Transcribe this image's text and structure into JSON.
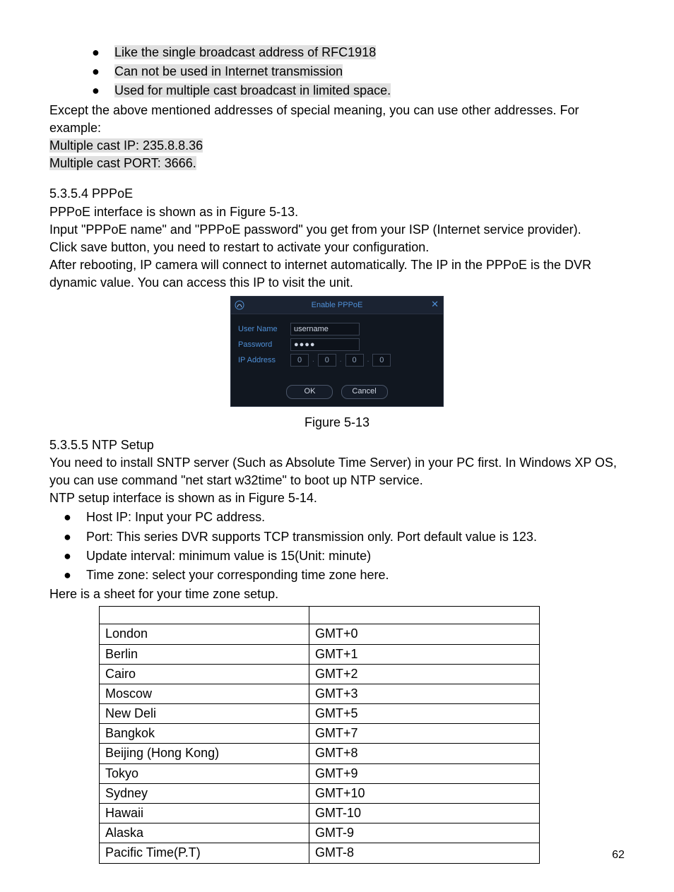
{
  "intro_bullets": [
    "Like the single broadcast address of RFC1918",
    "Can not be used in Internet transmission",
    "Used for multiple cast broadcast in limited space."
  ],
  "intro_para1": "Except the above mentioned addresses of special meaning, you can use other addresses. For example:",
  "intro_line_ip": "Multiple cast IP: 235.8.8.36",
  "intro_line_port": "Multiple cast PORT: 3666.",
  "pppoe": {
    "heading": "5.3.5.4  PPPoE",
    "p1": "PPPoE interface is shown as in Figure 5-13.",
    "p2": "Input \"PPPoE name\" and \"PPPoE password\" you get from your ISP (Internet service provider).",
    "p3": "Click save button, you need to restart to activate your configuration.",
    "p4": "After rebooting, IP camera will connect to internet automatically. The IP in the PPPoE is the DVR dynamic value. You can access this IP to visit the unit."
  },
  "dialog": {
    "title": "Enable PPPoE",
    "username_label": "User Name",
    "username_value": "username",
    "password_label": "Password",
    "password_value": "●●●●",
    "ip_label": "IP Address",
    "ip_octets": [
      "0",
      "0",
      "0",
      "0"
    ],
    "ok": "OK",
    "cancel": "Cancel"
  },
  "caption1": "Figure 5-13",
  "ntp": {
    "heading": "5.3.5.5  NTP Setup",
    "p1": "You need to install SNTP server (Such as Absolute Time Server) in your PC first. In Windows XP OS, you can use command \"net start w32time\" to boot up NTP service.",
    "p2": "NTP setup interface is shown as in Figure 5-14.",
    "bullets": [
      "Host IP: Input your PC address.",
      "Port:  This series DVR supports TCP transmission only. Port default value is 123.",
      "Update interval: minimum value is 15(Unit: minute)",
      "Time zone: select your corresponding time zone here."
    ],
    "p3": "Here is a sheet for your time zone setup."
  },
  "tz_table": [
    {
      "city": "",
      "gmt": ""
    },
    {
      "city": "London",
      "gmt": "GMT+0"
    },
    {
      "city": "Berlin",
      "gmt": "GMT+1"
    },
    {
      "city": "Cairo",
      "gmt": "GMT+2"
    },
    {
      "city": "Moscow",
      "gmt": "GMT+3"
    },
    {
      "city": "New Deli",
      "gmt": "GMT+5"
    },
    {
      "city": "Bangkok",
      "gmt": "GMT+7"
    },
    {
      "city": "Beijing (Hong Kong)",
      "gmt": "GMT+8"
    },
    {
      "city": "Tokyo",
      "gmt": "GMT+9"
    },
    {
      "city": "Sydney",
      "gmt": "GMT+10"
    },
    {
      "city": "Hawaii",
      "gmt": "GMT-10"
    },
    {
      "city": "Alaska",
      "gmt": "GMT-9"
    },
    {
      "city": "Pacific Time(P.T)",
      "gmt": "GMT-8"
    }
  ],
  "page_number": "62"
}
